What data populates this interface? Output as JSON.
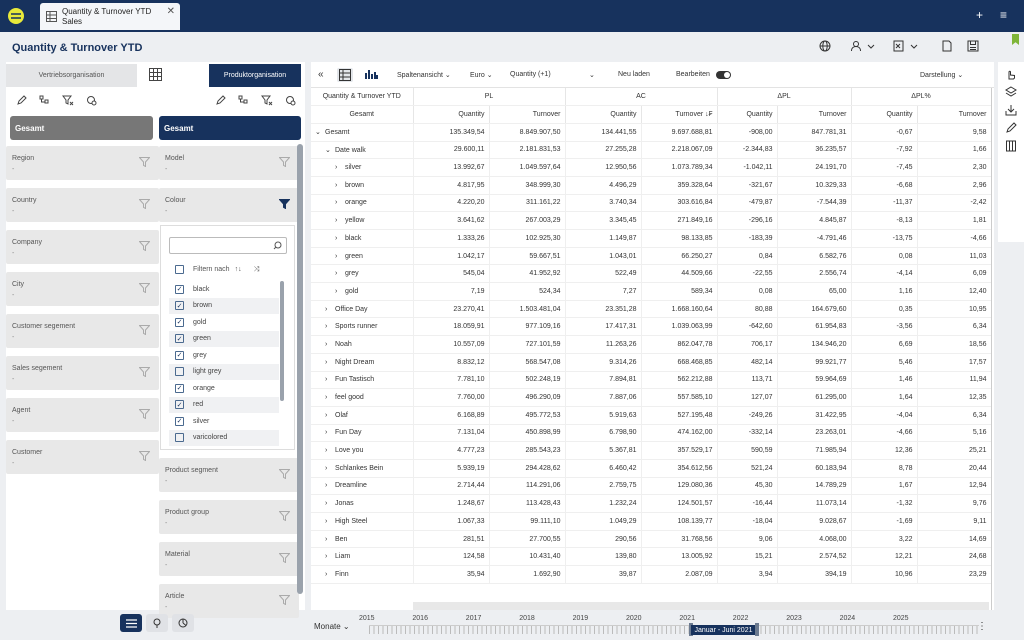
{
  "tab": {
    "title": "Quantity & Turnover YTD",
    "subtitle": "Sales"
  },
  "page_title": "Quantity & Turnover YTD",
  "sidebar": {
    "tab_left": "Vertriebsorganisation",
    "tab_right": "Produktorganisation",
    "left": {
      "root": "Gesamt",
      "filters": [
        {
          "label": "Region",
          "value": "-"
        },
        {
          "label": "Country",
          "value": "-"
        },
        {
          "label": "Company",
          "value": "-"
        },
        {
          "label": "City",
          "value": "-"
        },
        {
          "label": "Customer segement",
          "value": "-"
        },
        {
          "label": "Sales segement",
          "value": "-"
        },
        {
          "label": "Agent",
          "value": "-"
        },
        {
          "label": "Customer",
          "value": "-"
        }
      ]
    },
    "right": {
      "root": "Gesamt",
      "filters_top": [
        {
          "label": "Model",
          "value": "-"
        },
        {
          "label": "Colour",
          "value": "-"
        }
      ],
      "filter_header": "Filtern nach",
      "colours": [
        {
          "label": "black",
          "checked": true
        },
        {
          "label": "brown",
          "checked": true
        },
        {
          "label": "gold",
          "checked": true
        },
        {
          "label": "green",
          "checked": true
        },
        {
          "label": "grey",
          "checked": true
        },
        {
          "label": "light grey",
          "checked": false
        },
        {
          "label": "orange",
          "checked": true
        },
        {
          "label": "red",
          "checked": true
        },
        {
          "label": "silver",
          "checked": true
        },
        {
          "label": "varicolored",
          "checked": false
        }
      ],
      "filters_bottom": [
        {
          "label": "Product segment",
          "value": "-"
        },
        {
          "label": "Product group",
          "value": "-"
        },
        {
          "label": "Material",
          "value": "-"
        },
        {
          "label": "Article",
          "value": "-"
        }
      ]
    }
  },
  "toolbar": {
    "view": "Spaltenansicht",
    "currency": "Euro",
    "measure": "Quantity (+1)",
    "reload": "Neu laden",
    "edit": "Bearbeiten",
    "display": "Darstellung"
  },
  "table": {
    "corner": "Quantity & Turnover YTD",
    "row_header": "Gesamt",
    "groups": [
      "PL",
      "AC",
      "ΔPL",
      "ΔPL%"
    ],
    "subcols": [
      "Quantity",
      "Turnover",
      "Quantity",
      "Turnover ↓₣",
      "Quantity",
      "Turnover",
      "Quantity",
      "Turnover"
    ],
    "rows": [
      {
        "level": 0,
        "exp": "v",
        "name": "Gesamt",
        "v": [
          "135.349,54",
          "8.849.907,50",
          "134.441,55",
          "9.697.688,81",
          "-908,00",
          "847.781,31",
          "-0,67",
          "9,58"
        ]
      },
      {
        "level": 1,
        "exp": "v",
        "name": "Date walk",
        "v": [
          "29.600,11",
          "2.181.831,53",
          "27.255,28",
          "2.218.067,09",
          "-2.344,83",
          "36.235,57",
          "-7,92",
          "1,66"
        ]
      },
      {
        "level": 2,
        "exp": ">",
        "name": "silver",
        "v": [
          "13.992,67",
          "1.049.597,64",
          "12.950,56",
          "1.073.789,34",
          "-1.042,11",
          "24.191,70",
          "-7,45",
          "2,30"
        ]
      },
      {
        "level": 2,
        "exp": ">",
        "name": "brown",
        "v": [
          "4.817,95",
          "348.999,30",
          "4.496,29",
          "359.328,64",
          "-321,67",
          "10.329,33",
          "-6,68",
          "2,96"
        ]
      },
      {
        "level": 2,
        "exp": ">",
        "name": "orange",
        "v": [
          "4.220,20",
          "311.161,22",
          "3.740,34",
          "303.616,84",
          "-479,87",
          "-7.544,39",
          "-11,37",
          "-2,42"
        ]
      },
      {
        "level": 2,
        "exp": ">",
        "name": "yellow",
        "v": [
          "3.641,62",
          "267.003,29",
          "3.345,45",
          "271.849,16",
          "-296,16",
          "4.845,87",
          "-8,13",
          "1,81"
        ]
      },
      {
        "level": 2,
        "exp": ">",
        "name": "black",
        "v": [
          "1.333,26",
          "102.925,30",
          "1.149,87",
          "98.133,85",
          "-183,39",
          "-4.791,46",
          "-13,75",
          "-4,66"
        ]
      },
      {
        "level": 2,
        "exp": ">",
        "name": "green",
        "v": [
          "1.042,17",
          "59.667,51",
          "1.043,01",
          "66.250,27",
          "0,84",
          "6.582,76",
          "0,08",
          "11,03"
        ]
      },
      {
        "level": 2,
        "exp": ">",
        "name": "grey",
        "v": [
          "545,04",
          "41.952,92",
          "522,49",
          "44.509,66",
          "-22,55",
          "2.556,74",
          "-4,14",
          "6,09"
        ]
      },
      {
        "level": 2,
        "exp": ">",
        "name": "gold",
        "v": [
          "7,19",
          "524,34",
          "7,27",
          "589,34",
          "0,08",
          "65,00",
          "1,16",
          "12,40"
        ]
      },
      {
        "level": 1,
        "exp": ">",
        "name": "Office Day",
        "v": [
          "23.270,41",
          "1.503.481,04",
          "23.351,28",
          "1.668.160,64",
          "80,88",
          "164.679,60",
          "0,35",
          "10,95"
        ]
      },
      {
        "level": 1,
        "exp": ">",
        "name": "Sports runner",
        "v": [
          "18.059,91",
          "977.109,16",
          "17.417,31",
          "1.039.063,99",
          "-642,60",
          "61.954,83",
          "-3,56",
          "6,34"
        ]
      },
      {
        "level": 1,
        "exp": ">",
        "name": "Noah",
        "v": [
          "10.557,09",
          "727.101,59",
          "11.263,26",
          "862.047,78",
          "706,17",
          "134.946,20",
          "6,69",
          "18,56"
        ]
      },
      {
        "level": 1,
        "exp": ">",
        "name": "Night Dream",
        "v": [
          "8.832,12",
          "568.547,08",
          "9.314,26",
          "668.468,85",
          "482,14",
          "99.921,77",
          "5,46",
          "17,57"
        ]
      },
      {
        "level": 1,
        "exp": ">",
        "name": "Fun Tastisch",
        "v": [
          "7.781,10",
          "502.248,19",
          "7.894,81",
          "562.212,88",
          "113,71",
          "59.964,69",
          "1,46",
          "11,94"
        ]
      },
      {
        "level": 1,
        "exp": ">",
        "name": "feel good",
        "v": [
          "7.760,00",
          "496.290,09",
          "7.887,06",
          "557.585,10",
          "127,07",
          "61.295,00",
          "1,64",
          "12,35"
        ]
      },
      {
        "level": 1,
        "exp": ">",
        "name": "Olaf",
        "v": [
          "6.168,89",
          "495.772,53",
          "5.919,63",
          "527.195,48",
          "-249,26",
          "31.422,95",
          "-4,04",
          "6,34"
        ]
      },
      {
        "level": 1,
        "exp": ">",
        "name": "Fun Day",
        "v": [
          "7.131,04",
          "450.898,99",
          "6.798,90",
          "474.162,00",
          "-332,14",
          "23.263,01",
          "-4,66",
          "5,16"
        ]
      },
      {
        "level": 1,
        "exp": ">",
        "name": "Love you",
        "v": [
          "4.777,23",
          "285.543,23",
          "5.367,81",
          "357.529,17",
          "590,59",
          "71.985,94",
          "12,36",
          "25,21"
        ]
      },
      {
        "level": 1,
        "exp": ">",
        "name": "Schlankes Bein",
        "v": [
          "5.939,19",
          "294.428,62",
          "6.460,42",
          "354.612,56",
          "521,24",
          "60.183,94",
          "8,78",
          "20,44"
        ]
      },
      {
        "level": 1,
        "exp": ">",
        "name": "Dreamline",
        "v": [
          "2.714,44",
          "114.291,06",
          "2.759,75",
          "129.080,36",
          "45,30",
          "14.789,29",
          "1,67",
          "12,94"
        ]
      },
      {
        "level": 1,
        "exp": ">",
        "name": "Jonas",
        "v": [
          "1.248,67",
          "113.428,43",
          "1.232,24",
          "124.501,57",
          "-16,44",
          "11.073,14",
          "-1,32",
          "9,76"
        ]
      },
      {
        "level": 1,
        "exp": ">",
        "name": "High Steel",
        "v": [
          "1.067,33",
          "99.111,10",
          "1.049,29",
          "108.139,77",
          "-18,04",
          "9.028,67",
          "-1,69",
          "9,11"
        ]
      },
      {
        "level": 1,
        "exp": ">",
        "name": "Ben",
        "v": [
          "281,51",
          "27.700,55",
          "290,56",
          "31.768,56",
          "9,06",
          "4.068,00",
          "3,22",
          "14,69"
        ]
      },
      {
        "level": 1,
        "exp": ">",
        "name": "Liam",
        "v": [
          "124,58",
          "10.431,40",
          "139,80",
          "13.005,92",
          "15,21",
          "2.574,52",
          "12,21",
          "24,68"
        ]
      },
      {
        "level": 1,
        "exp": ">",
        "name": "Finn",
        "v": [
          "35,94",
          "1.692,90",
          "39,87",
          "2.087,09",
          "3,94",
          "394,19",
          "10,96",
          "23,29"
        ]
      }
    ]
  },
  "timeline": {
    "unit": "Monate",
    "years": [
      "2015",
      "2016",
      "2017",
      "2018",
      "2019",
      "2020",
      "2021",
      "2022",
      "2023",
      "2024",
      "2025"
    ],
    "selection": "Januar - Juni 2021"
  }
}
